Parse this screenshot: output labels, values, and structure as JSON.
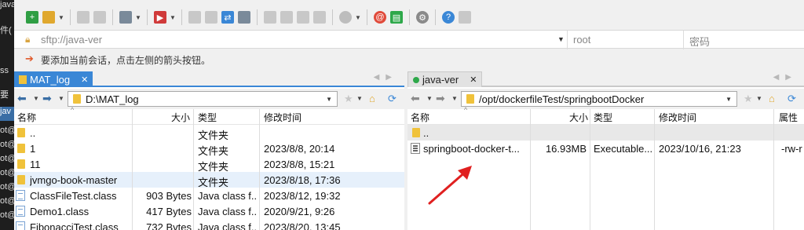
{
  "terminal_strip": {
    "lines": [
      "java",
      "件(",
      "",
      "ss",
      "要",
      "jav",
      "ot@",
      "ot@",
      "ot@",
      "ot@",
      "ot@",
      "ot@",
      "ot@"
    ]
  },
  "session": {
    "url": "sftp://java-ver",
    "username": "root",
    "password_placeholder": "密码",
    "hint": "要添加当前会话，点击左侧的箭头按钮。"
  },
  "local": {
    "tab_label": "MAT_log",
    "path": "D:\\MAT_log",
    "columns": {
      "name": "名称",
      "size": "大小",
      "type": "类型",
      "mtime": "修改时间"
    },
    "rows": [
      {
        "icon": "folder",
        "name": "..",
        "size": "",
        "type": "文件夹",
        "mtime": ""
      },
      {
        "icon": "folder",
        "name": "1",
        "size": "",
        "type": "文件夹",
        "mtime": "2023/8/8, 20:14"
      },
      {
        "icon": "folder",
        "name": "11",
        "size": "",
        "type": "文件夹",
        "mtime": "2023/8/8, 15:21"
      },
      {
        "icon": "folder",
        "name": "jvmgo-book-master",
        "size": "",
        "type": "文件夹",
        "mtime": "2023/8/18, 17:36"
      },
      {
        "icon": "class",
        "name": "ClassFileTest.class",
        "size": "903 Bytes",
        "type": "Java class f...",
        "mtime": "2023/8/12, 19:32"
      },
      {
        "icon": "class",
        "name": "Demo1.class",
        "size": "417 Bytes",
        "type": "Java class f...",
        "mtime": "2020/9/21, 9:26"
      },
      {
        "icon": "class",
        "name": "FibonacciTest.class",
        "size": "732 Bytes",
        "type": "Java class f...",
        "mtime": "2023/8/20, 13:45"
      }
    ]
  },
  "remote": {
    "tab_label": "java-ver",
    "path": "/opt/dockerfileTest/springbootDocker",
    "columns": {
      "name": "名称",
      "size": "大小",
      "type": "类型",
      "mtime": "修改时间",
      "attr": "属性"
    },
    "rows": [
      {
        "icon": "folder",
        "name": "..",
        "size": "",
        "type": "",
        "mtime": "",
        "attr": ""
      },
      {
        "icon": "exec",
        "name": "springboot-docker-t...",
        "size": "16.93MB",
        "type": "Executable...",
        "mtime": "2023/10/16, 21:23",
        "attr": "-rw-r"
      }
    ]
  },
  "colors": {
    "accent": "#3a87d6",
    "annotation": "#e02020",
    "folder": "#f0c23b",
    "online": "#2ea84a"
  }
}
